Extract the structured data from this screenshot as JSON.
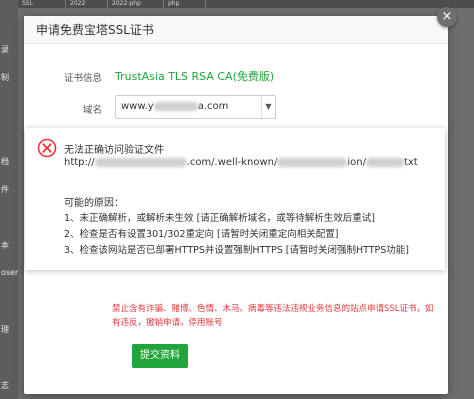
{
  "background": {
    "sidebar_items": [
      "录",
      "制",
      "档",
      "件",
      "本",
      "oser",
      "理",
      "志"
    ],
    "tabs": [
      "SSL",
      "2022",
      "2022-php",
      "php"
    ]
  },
  "dialog": {
    "title": "申请免费宝塔SSL证书",
    "close_glyph": "×",
    "cert_label": "证书信息",
    "cert_name": "TrustAsia TLS RSA CA(免费版)",
    "domain_label": "域名",
    "domain_value_start": "www.y",
    "domain_value_end": "a.com",
    "warning": "禁止含有诈骗、赌博、色情、木马、病毒等违法违规业务信息的站点申请SSL证书，如有违反，撤销申请，停用账号",
    "submit_label": "提交资料"
  },
  "error_popup": {
    "title": "无法正确访问验证文件",
    "url_start": "http://",
    "url_mid": ".com/.well-known/",
    "url_mid2": "ion/",
    "url_end": "txt",
    "reasons_title": "可能的原因：",
    "reasons": [
      "1、未正确解析，或解析未生效 [请正确解析域名，或等待解析生效后重试]",
      "2、检查是否有设置301/302重定向 [请暂时关闭重定向相关配置]",
      "3、检查该网站是否已部署HTTPS并设置强制HTTPS [请暂时关闭强制HTTPS功能]"
    ]
  },
  "colors": {
    "accent_green": "#20a53a",
    "error_red": "#e4393c",
    "warning_red": "#e4393c"
  }
}
